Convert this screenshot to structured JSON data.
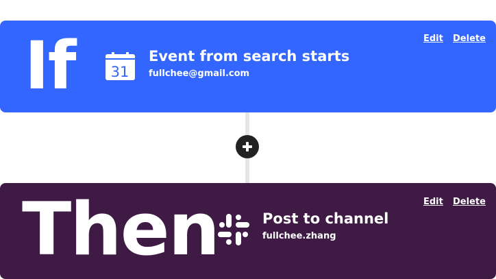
{
  "if_step": {
    "keyword": "If",
    "title": "Event from search starts",
    "account": "fullchee@gmail.com",
    "icon": "google-calendar-icon",
    "icon_day": "31",
    "edit_label": "Edit",
    "delete_label": "Delete",
    "color": "#3366ff"
  },
  "add_step": {
    "icon": "plus-icon"
  },
  "then_step": {
    "keyword": "Then",
    "title": "Post to channel",
    "account": "fullchee.zhang",
    "icon": "slack-icon",
    "edit_label": "Edit",
    "delete_label": "Delete",
    "color": "#3e1a45"
  }
}
